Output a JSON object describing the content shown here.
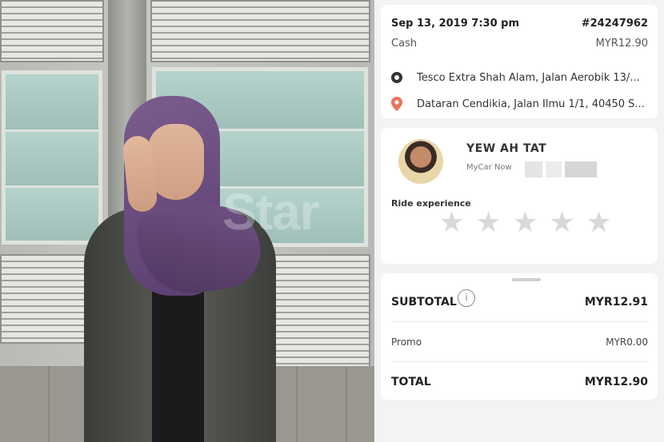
{
  "photo": {
    "watermark": "Star"
  },
  "trip": {
    "date": "Sep 13, 2019 7:30 pm",
    "order_no": "#24247962",
    "payment": "Cash",
    "fare": "MYR12.90",
    "pickup": "Tesco Extra Shah Alam, Jalan Aerobik 13/...",
    "dropoff": "Dataran Cendikia, Jalan Ilmu 1/1, 40450 S...",
    "pickup_icon_color": "#333333",
    "dropoff_icon_color": "#e8735a"
  },
  "driver": {
    "name": "YEW AH TAT",
    "vehicle": "MyCar Now",
    "ride_experience_label": "Ride experience",
    "rating_stars": 0,
    "star_glyph": "★",
    "star_color": "#d9d9d9"
  },
  "summary": {
    "subtotal_label": "SUBTOTAL",
    "subtotal": "MYR12.91",
    "info_glyph": "i",
    "promo_label": "Promo",
    "promo": "MYR0.00",
    "total_label": "TOTAL",
    "total": "MYR12.90"
  }
}
